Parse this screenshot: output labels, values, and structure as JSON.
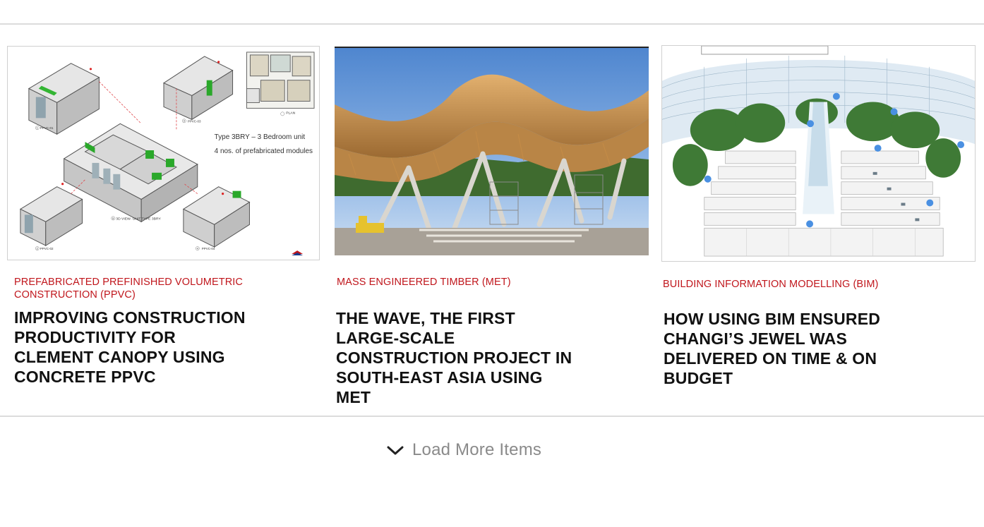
{
  "articles": [
    {
      "category": "PREFABRICATED PREFINISHED VOLUMETRIC CONSTRUCTION (PPVC)",
      "title": "IMPROVING CONSTRUCTION PRODUCTIVITY FOR CLEMENT CANOPY USING CONCRETE PPVC",
      "image": {
        "subject": "PPVC module exploded isometric diagram",
        "labels": {
          "type_line": "Type 3BRY – 3 Bedroom unit",
          "modules_line": "4 nos. of prefabricated modules",
          "view_label": "3D VIEW- UNIT TYPE 3BRY",
          "plan_label": "PLAN",
          "module_1": "PPVC-01",
          "module_2": "PPVC-02",
          "module_3": "PPVC-03",
          "module_4": "PPVC-04",
          "num_1": "1",
          "num_2": "2",
          "num_3": "3",
          "num_4": "4",
          "num_5": "5"
        }
      }
    },
    {
      "category": "MASS ENGINEERED TIMBER (MET)",
      "title": "THE WAVE, THE FIRST LARGE-SCALE CONSTRUCTION PROJECT IN SOUTH-EAST ASIA USING MET",
      "image": {
        "subject": "Timber wave roof building under construction"
      }
    },
    {
      "category": "BUILDING INFORMATION MODELLING (BIM)",
      "title": "HOW USING BIM ENSURED CHANGI’S JEWEL WAS DELIVERED ON TIME & ON BUDGET",
      "image": {
        "subject": "Cutaway rendering of Jewel Changi with vortex waterfall"
      }
    }
  ],
  "load_more": {
    "label": "Load More Items",
    "icon": "chevron-down-icon"
  },
  "colors": {
    "category": "#c0161c",
    "headline": "#111111",
    "rule": "#dcdcdc",
    "load_more": "#8a8a8a",
    "bim_marker": "#4a90e2"
  }
}
